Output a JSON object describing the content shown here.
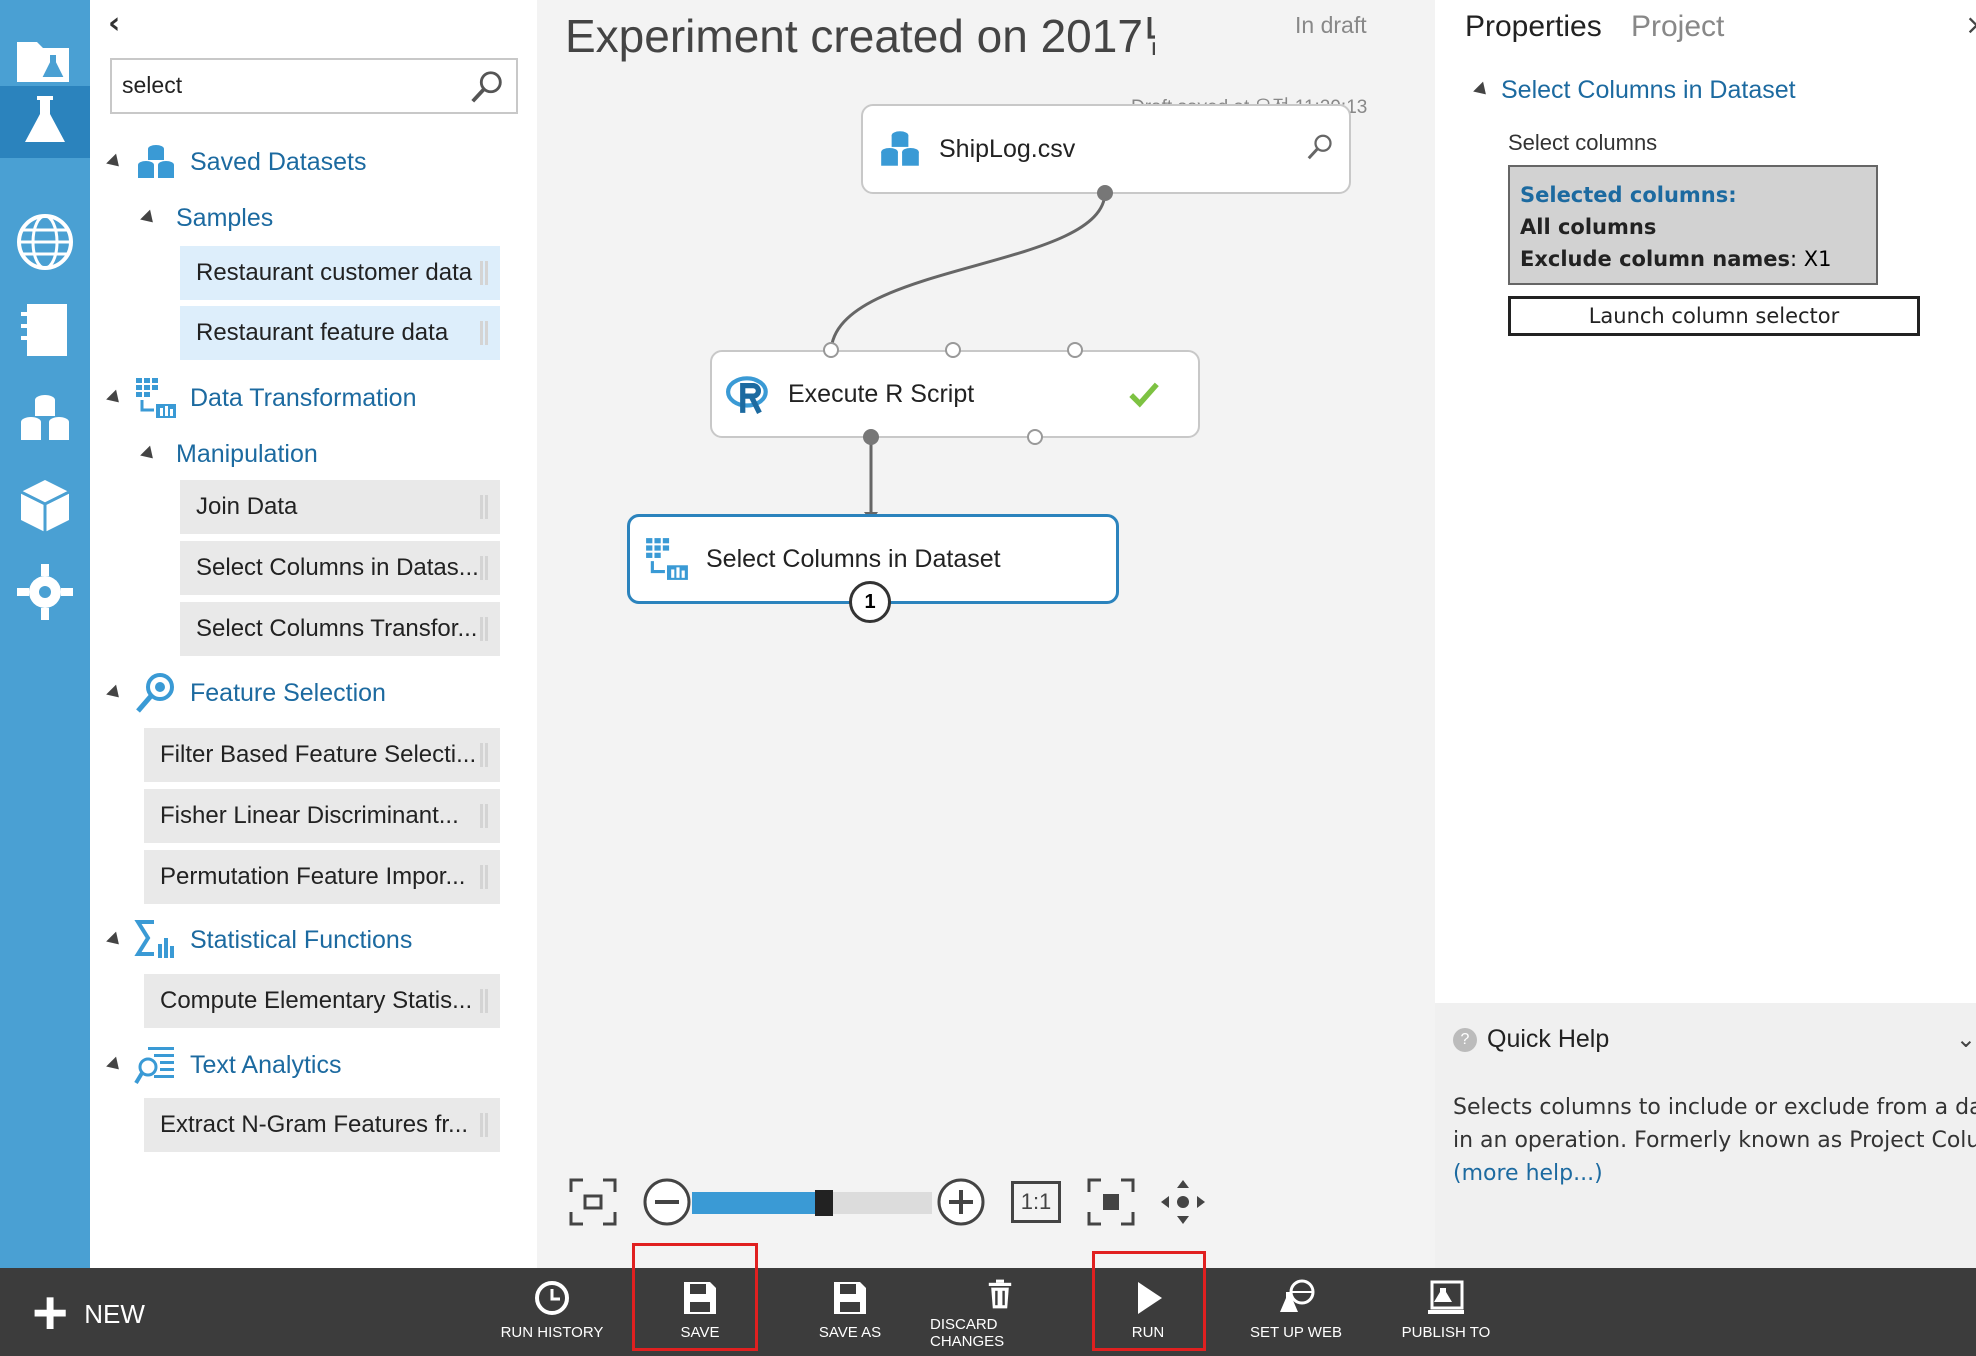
{
  "rail": {
    "items": [
      {
        "icon": "projects-icon"
      },
      {
        "icon": "experiments-icon",
        "active": true
      },
      {
        "icon": "web-services-icon"
      },
      {
        "icon": "notebooks-icon"
      },
      {
        "icon": "datasets-icon"
      },
      {
        "icon": "trained-models-icon"
      },
      {
        "icon": "settings-icon"
      }
    ]
  },
  "palette": {
    "collapse_glyph": "‹",
    "search_value": "select",
    "categories": {
      "saved_datasets": "Saved Datasets",
      "samples": "Samples",
      "data_transformation": "Data Transformation",
      "manipulation": "Manipulation",
      "feature_selection": "Feature Selection",
      "statistical_functions": "Statistical Functions",
      "text_analytics": "Text Analytics"
    },
    "items": {
      "restaurant_customer": "Restaurant customer data",
      "restaurant_feature": "Restaurant feature data",
      "join_data": "Join Data",
      "select_columns_dataset": "Select Columns in Datas...",
      "select_columns_transform": "Select Columns Transfor...",
      "filter_based": "Filter Based Feature Selecti...",
      "fisher_lda": "Fisher Linear Discriminant...",
      "permutation": "Permutation Feature Impor...",
      "compute_stats": "Compute Elementary Statis...",
      "extract_ngram": "Extract N-Gram Features fr..."
    }
  },
  "canvas": {
    "title": "Experiment created on 2017년",
    "status": "In draft",
    "saved_at": "Draft saved at 오전 11:29:13",
    "modules": {
      "shiplog": "ShipLog.csv",
      "execute_r": "Execute R Script",
      "select_columns": "Select Columns in Dataset"
    },
    "badge_number": "1",
    "zoom_fraction": 0.55,
    "zoom_actual_label": "1:1",
    "accent_color": "#2b83bd"
  },
  "properties": {
    "tab_properties": "Properties",
    "tab_project": "Project",
    "close_glyph": "×",
    "section_title": "Select Columns in Dataset",
    "select_columns_label": "Select columns",
    "selected_columns_heading": "Selected columns:",
    "all_columns": "All columns",
    "exclude_label": "Exclude column names",
    "exclude_value": ": X1",
    "launch_button": "Launch column selector",
    "quick_help": {
      "title": "Quick Help",
      "q_glyph": "?",
      "chevron": "⌄",
      "line1": "Selects columns to include or exclude from a dataset",
      "line2": "in an operation. Formerly known as Project Columns",
      "more_link": "(more help...)"
    }
  },
  "bottombar": {
    "new_label": "NEW",
    "buttons": {
      "run_history": "RUN HISTORY",
      "save": "SAVE",
      "save_as": "SAVE AS",
      "discard": "DISCARD CHANGES",
      "run": "RUN",
      "setup_web": "SET UP WEB",
      "publish": "PUBLISH TO"
    },
    "highlight_color": "#e02020"
  }
}
